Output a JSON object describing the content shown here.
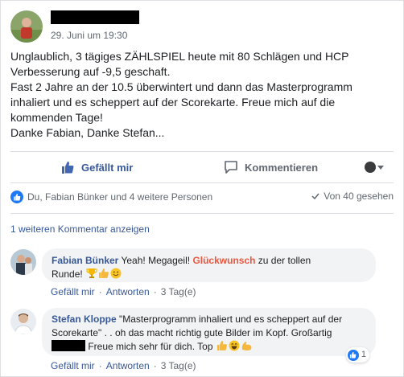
{
  "post": {
    "timestamp": "29. Juni um 19:30",
    "lines": [
      "Unglaublich, 3 tägiges ZÄHLSPIEL heute mit 80 Schlägen und HCP",
      "Verbesserung auf -9,5 geschaft.",
      "Fast 2 Jahre an der 10.5 überwintert und dann das Masterprogramm",
      "inhaliert und es scheppert auf der Scorekarte. Freue mich auf die",
      "kommenden Tage!",
      "Danke Fabian, Danke Stefan..."
    ]
  },
  "actions": {
    "like": "Gefällt mir",
    "comment": "Kommentieren"
  },
  "reactions": {
    "people": "Du, Fabian Bünker und 4 weitere Personen",
    "seen": "Von 40 gesehen"
  },
  "more_comments": "1 weiteren Kommentar anzeigen",
  "comments": [
    {
      "author": "Fabian Bünker",
      "text_before": " Yeah! Megageil! ",
      "highlight": "Glückwunsch",
      "text_after": " zu der tollen",
      "line2": "Runde!",
      "like": "Gefällt mir",
      "reply": "Antworten",
      "age": "3 Tag(e)"
    },
    {
      "author": "Stefan Kloppe",
      "line1": " \"Masterprogramm inhaliert und es scheppert auf der",
      "line2": "Scorekarte\" . . oh das macht richtig gute Bilder im Kopf. Großartig",
      "line3": " Freue mich sehr für dich. Top",
      "reaction_count": "1",
      "like": "Gefällt mir",
      "reply": "Antworten",
      "age": "3 Tag(e)"
    }
  ],
  "colors": {
    "link": "#385898",
    "like_blue": "#2078f4",
    "highlight": "#e9573f",
    "muted": "#606770"
  },
  "icons": [
    "thumbs-up-icon",
    "comment-icon",
    "globe-icon",
    "caret-down-icon",
    "trophy-emoji",
    "thumbs-up-emoji",
    "smile-emoji",
    "laugh-emoji",
    "muscle-emoji",
    "eye-icon"
  ]
}
